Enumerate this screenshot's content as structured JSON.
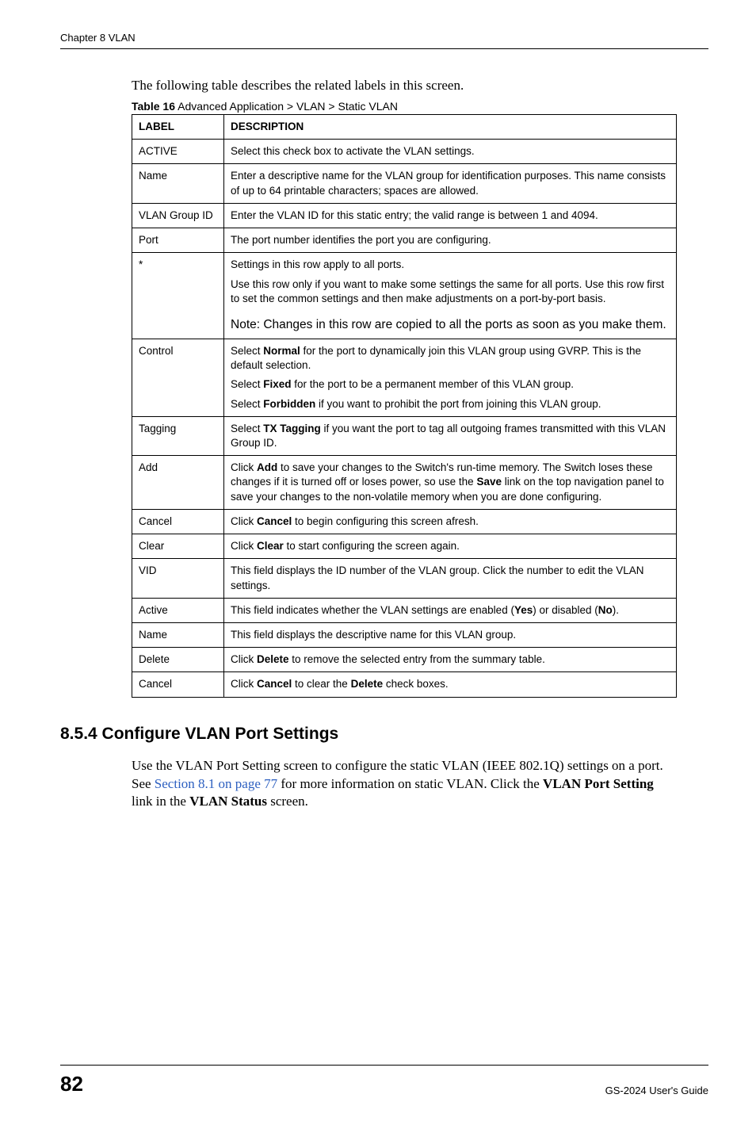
{
  "running_head": "Chapter 8 VLAN",
  "intro": "The following table describes the related labels in this screen.",
  "table_caption_label": "Table 16",
  "table_caption_rest": "   Advanced Application > VLAN > Static VLAN",
  "header_label": "LABEL",
  "header_desc": "DESCRIPTION",
  "rows": [
    {
      "label": "ACTIVE",
      "desc": [
        {
          "t": "Select this check box to activate the VLAN settings."
        }
      ]
    },
    {
      "label": "Name",
      "desc": [
        {
          "t": "Enter a descriptive name for the VLAN group for identification purposes. This name consists of up to 64 printable characters; spaces are allowed."
        }
      ]
    },
    {
      "label": "VLAN Group ID",
      "desc": [
        {
          "t": "Enter the VLAN ID for this static entry; the valid range is between 1 and 4094."
        }
      ]
    },
    {
      "label": "Port",
      "desc": [
        {
          "t": "The port number identifies the port you are configuring."
        }
      ]
    },
    {
      "label": "*",
      "desc": [
        {
          "t": "Settings in this row apply to all ports."
        },
        {
          "t": "Use this row only if you want to make some settings the same for all ports. Use this row first to set the common settings and then make adjustments on a port-by-port basis."
        },
        {
          "t": "Note: Changes in this row are copied to all the ports as soon as you make them.",
          "note": true
        }
      ]
    },
    {
      "label": "Control",
      "desc": [
        {
          "t": "Select <b>Normal</b> for the port to dynamically join this VLAN group using GVRP. This is the default selection."
        },
        {
          "t": "Select <b>Fixed</b> for the port to be a permanent member of this VLAN group."
        },
        {
          "t": "Select <b>Forbidden</b> if you want to prohibit the port from joining this VLAN group."
        }
      ]
    },
    {
      "label": "Tagging",
      "desc": [
        {
          "t": "Select <b>TX Tagging</b> if you want the port to tag all outgoing frames transmitted with this VLAN Group ID."
        }
      ]
    },
    {
      "label": "Add",
      "desc": [
        {
          "t": "Click <b>Add</b> to save your changes to the Switch's run-time memory. The Switch loses these changes if it is turned off or loses power, so use the <b>Save</b> link on the top navigation panel to save your changes to the non-volatile memory when you are done configuring."
        }
      ]
    },
    {
      "label": "Cancel",
      "desc": [
        {
          "t": "Click <b>Cancel</b> to begin configuring this screen afresh."
        }
      ]
    },
    {
      "label": "Clear",
      "desc": [
        {
          "t": "Click <b>Clear</b> to start configuring the screen again."
        }
      ]
    },
    {
      "label": "VID",
      "desc": [
        {
          "t": "This field displays the ID number of the VLAN group. Click the number to edit the VLAN settings."
        }
      ]
    },
    {
      "label": "Active",
      "desc": [
        {
          "t": "This field indicates whether the VLAN settings are enabled (<b>Yes</b>) or disabled (<b>No</b>)."
        }
      ]
    },
    {
      "label": "Name",
      "desc": [
        {
          "t": "This field displays the descriptive name for this VLAN group."
        }
      ]
    },
    {
      "label": "Delete",
      "desc": [
        {
          "t": "Click <b>Delete</b> to remove the selected entry from the summary table."
        }
      ]
    },
    {
      "label": "Cancel",
      "desc": [
        {
          "t": "Click <b>Cancel</b> to clear the <b>Delete</b> check boxes."
        }
      ]
    }
  ],
  "section_heading": "8.5.4  Configure VLAN Port Settings",
  "body_1a": "Use the VLAN Port Setting screen to configure the static VLAN (IEEE 802.1Q) settings on a port. See ",
  "body_link": "Section 8.1 on page 77",
  "body_1b": " for more information on static VLAN. Click the ",
  "body_bold1": "VLAN Port Setting",
  "body_1c": " link in the ",
  "body_bold2": "VLAN Status",
  "body_1d": " screen.",
  "page_num": "82",
  "guide_name": "GS-2024 User's Guide"
}
